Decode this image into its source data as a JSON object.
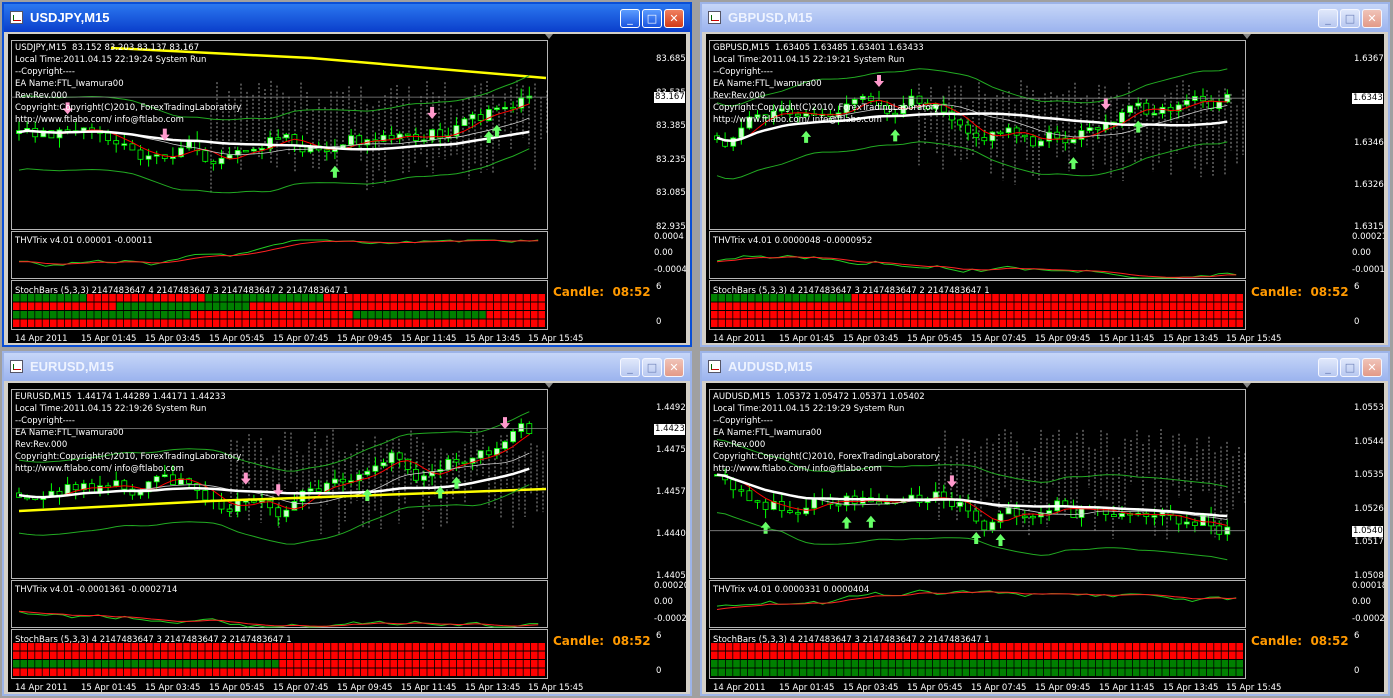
{
  "windows": [
    {
      "id": "usdjpy",
      "active": true,
      "title": "USDJPY,M15",
      "info": [
        "USDJPY,M15  83.152 83.203 83.137 83.167",
        "Local Time:2011.04.15 22:19:24 System Run",
        "--Copyright----",
        "EA Name:FTL_Iwamura00",
        "Rev:Rev.000",
        "Copyright:Copyright(C)2010, ForexTradingLaboratory",
        "http://www.ftlabo.com/ info@ftlabo.com"
      ],
      "price_ticks": [
        "83.685",
        "83.535",
        "83.385",
        "83.235",
        "83.085",
        "82.935"
      ],
      "current_price": "83.167",
      "trix_label": "THVTrix v4.01 0.00001 -0.00011",
      "trix_ticks": [
        "0.0004",
        "0.00",
        "-0.00042"
      ],
      "stoch_label": "StochBars (5,3,3) 2147483647 4 2147483647 3 2147483647 2 2147483647 1",
      "stoch_ticks": [
        "6",
        "0"
      ],
      "candle": "Candle:  08:52",
      "stoch_rows": [
        "GGGGGGGGGGRRRRRRRRRRRRRRRRGGGGGGGGGGGGGGGGRRRRRRRRRRRRRRRRRRRRRRRRRRRRRR",
        "RRRRRRRRRRRRRRGGGGGGGGGGGGGGGGGGRRRRRRRRRRRRRRRRRRRRRRRRRRRRRRRRRRRRRRRR",
        "GGGGGGGGGGGGGGGGGGGGGGGGRRRRRRRRRRRRRRRRRRRRRRGGGGGGGGGGGGGGGGGGRRRRRRRR",
        "RRRRRRRRRRRRRRRRRRRRRRRRRRRRRRRRRRRRRRRRRRRRRRRRRRRRRRRRRRRRRRRRRRRRRRRR"
      ]
    },
    {
      "id": "gbpusd",
      "active": false,
      "title": "GBPUSD,M15",
      "info": [
        "GBPUSD,M15  1.63405 1.63485 1.63401 1.63433",
        "Local Time:2011.04.15 22:19:21 System Run",
        "--Copyright----",
        "EA Name:FTL_Iwamura00",
        "Rev:Rev.000",
        "Copyright:Copyright(C)2010, ForexTradingLaboratory",
        "http://www.ftlabo.com/ info@ftlabo.com"
      ],
      "price_ticks": [
        "1.63675",
        "1.63570",
        "1.63465",
        "1.63260",
        "1.63155"
      ],
      "current_price": "1.63433",
      "trix_label": "THVTrix v4.01 0.0000048 -0.0000952",
      "trix_ticks": [
        "0.000213",
        "0.00",
        "-0.00012"
      ],
      "stoch_label": "StochBars (5,3,3) 4 2147483647 3 2147483647 2 2147483647 1",
      "stoch_ticks": [
        "6",
        "0"
      ],
      "candle": "Candle:  08:52",
      "stoch_rows": [
        "GGGGGGGGGGGGGGGGGGGRRRRRRRRRRRRRRRRRRRRRRRRRRRRRRRRRRRRRRRRRRRRRRRRRRRRR",
        "RRRRRRRRRRRRRRRRRRRRRRRRRRRRRRRRRRRRRRRRRRRRRRRRRRRRRRRRRRRRRRRRRRRRRRRR",
        "RRRRRRRRRRRRRRRRRRRRRRRRRRRRRRRRRRRRRRRRRRRRRRRRRRRRRRRRRRRRRRRRRRRRRRRR",
        "RRRRRRRRRRRRRRRRRRRRRRRRRRRRRRRRRRRRRRRRRRRRRRRRRRRRRRRRRRRRRRRRRRRRRRRR"
      ]
    },
    {
      "id": "eurusd",
      "active": false,
      "title": "EURUSD,M15",
      "info": [
        "EURUSD,M15  1.44174 1.44289 1.44171 1.44233",
        "Local Time:2011.04.15 22:19:26 System Run",
        "--Copyright----",
        "EA Name:FTL_Iwamura00",
        "Rev:Rev.000",
        "Copyright:Copyright(C)2010, ForexTradingLaboratory",
        "http://www.ftlabo.com/ info@ftlabo.com"
      ],
      "price_ticks": [
        "1.44925",
        "1.44750",
        "1.44575",
        "1.44400",
        "1.44050"
      ],
      "current_price": "1.44233",
      "trix_label": "THVTrix v4.01 -0.0001361 -0.0002714",
      "trix_ticks": [
        "0.000202",
        "0.00",
        "-0.00029"
      ],
      "stoch_label": "StochBars (5,3,3) 4 2147483647 3 2147483647 2 2147483647 1",
      "stoch_ticks": [
        "6",
        "0"
      ],
      "candle": "Candle:  08:52",
      "stoch_rows": [
        "RRRRRRRRRRRRRRRRRRRRRRRRRRRRRRRRRRRRRRRRRRRRRRRRRRRRRRRRRRRRRRRRRRRRRRRR",
        "RRRRRRRRRRRRRRRRRRRRRRRRRRRRRRRRRRRRRRRRRRRRRRRRRRRRRRRRRRRRRRRRRRRRRRRR",
        "GGGGGGGGGGGGGGGGGGGGGGGGGGGGGGGGGGGGRRRRRRRRRRRRRRRRRRRRRRRRRRRRRRRRRRRR",
        "RRRRRRRRRRRRRRRRRRRRRRRRRRRRRRRRRRRRRRRRRRRRRRRRRRRRRRRRRRRRRRRRRRRRRRRR"
      ]
    },
    {
      "id": "audusd",
      "active": false,
      "title": "AUDUSD,M15",
      "info": [
        "AUDUSD,M15  1.05372 1.05472 1.05371 1.05402",
        "Local Time:2011.04.15 22:19:29 System Run",
        "--Copyright----",
        "EA Name:FTL_Iwamura00",
        "Rev:Rev.000",
        "Copyright:Copyright(C)2010, ForexTradingLaboratory",
        "http://www.ftlabo.com/ info@ftlabo.com"
      ],
      "price_ticks": [
        "1.05535",
        "1.05445",
        "1.05355",
        "1.05265",
        "1.05175",
        "1.05085"
      ],
      "current_price": "1.05402",
      "trix_label": "THVTrix v4.01 0.0000331 0.0000404",
      "trix_ticks": [
        "0.000183",
        "0.00",
        "-0.00020"
      ],
      "stoch_label": "StochBars (5,3,3) 4 2147483647 3 2147483647 2 2147483647 1",
      "stoch_ticks": [
        "6",
        "0"
      ],
      "candle": "Candle:  08:52",
      "stoch_rows": [
        "RRRRRRRRRRRRRRRRRRRRRRRRRRRRRRRRRRRRRRRRRRRRRRRRRRRRRRRRRRRRRRRRRRRRRRRR",
        "RRRRRRRRRRRRRRRRRRRRRRRRRRRRRRRRRRRRRRRRRRRRRRRRRRRRRRRRRRRRRRRRRRRRRRRR",
        "GGGGGGGGGGGGGGGGGGGGGGGGGGGGGGGGGGGGGGGGGGGGGGGGGGGGGGGGGGGGGGGGGGGGGGGG",
        "GGGGGGGGGGGGGGGGGGGGGGGGGGGGGGGGGGGGGGGGGGGGGGGGGGGGGGGGGGGGGGGGGGGGGGGG"
      ]
    }
  ],
  "time_labels": [
    "14 Apr 2011",
    "15 Apr 01:45",
    "15 Apr 03:45",
    "15 Apr 05:45",
    "15 Apr 07:45",
    "15 Apr 09:45",
    "15 Apr 11:45",
    "15 Apr 13:45",
    "15 Apr 15:45"
  ],
  "colors": {
    "bull_candle": "#ccffcc",
    "bear_candle": "#000000",
    "ma_red": "#ff0000",
    "ma_white": "#ffffff",
    "ma_yellow": "#ffff00",
    "ma_green": "#22aa22",
    "stoch_green": "#008000",
    "stoch_red": "#ff0000",
    "candle_text": "#ff9900",
    "arrow_up": "#66ff66",
    "arrow_down": "#ff99cc"
  },
  "window_buttons": {
    "minimize": "_",
    "maximize": "□",
    "close": "✕"
  }
}
